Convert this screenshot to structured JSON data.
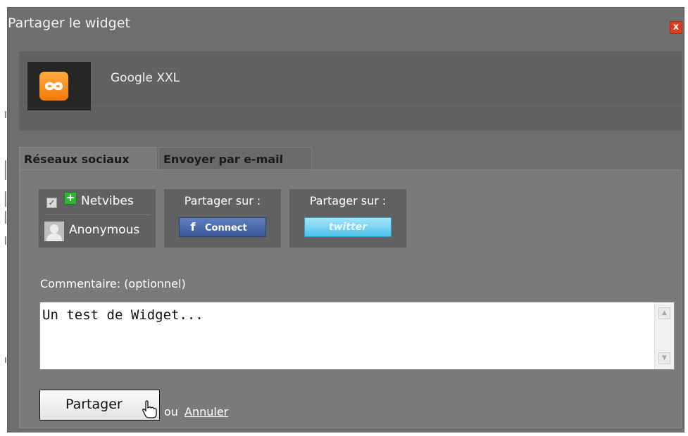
{
  "dialog": {
    "title": "Partager le widget",
    "close_glyph": "x"
  },
  "widget": {
    "name": "Google XXL",
    "icon": "infinity-icon"
  },
  "tabs": [
    {
      "label": "Réseaux sociaux",
      "active": true
    },
    {
      "label": "Envoyer par e-mail",
      "active": false
    }
  ],
  "netvibes": {
    "checkbox_glyph": "✓",
    "plus_glyph": "+",
    "label": "Netvibes",
    "user_label": "Anonymous"
  },
  "facebook": {
    "share_label": "Partager sur :",
    "icon_glyph": "f",
    "button_label": "Connect"
  },
  "twitter": {
    "share_label": "Partager sur :",
    "button_label": "twitter"
  },
  "comment": {
    "label": "Commentaire: (optionnel)",
    "value": "Un test de Widget...",
    "scroll_up_glyph": "▲",
    "scroll_down_glyph": "▼"
  },
  "actions": {
    "submit_label": "Partager",
    "or_text": "ou",
    "cancel_label": "Annuler"
  },
  "colors": {
    "dialog_bg": "#6f6f6f",
    "panel_bg": "#7a7a7a",
    "box_bg": "#616161",
    "facebook_blue": "#3b5998",
    "twitter_blue": "#4cc2ed",
    "close_red": "#e23b1b",
    "icon_orange": "#f5780c"
  }
}
